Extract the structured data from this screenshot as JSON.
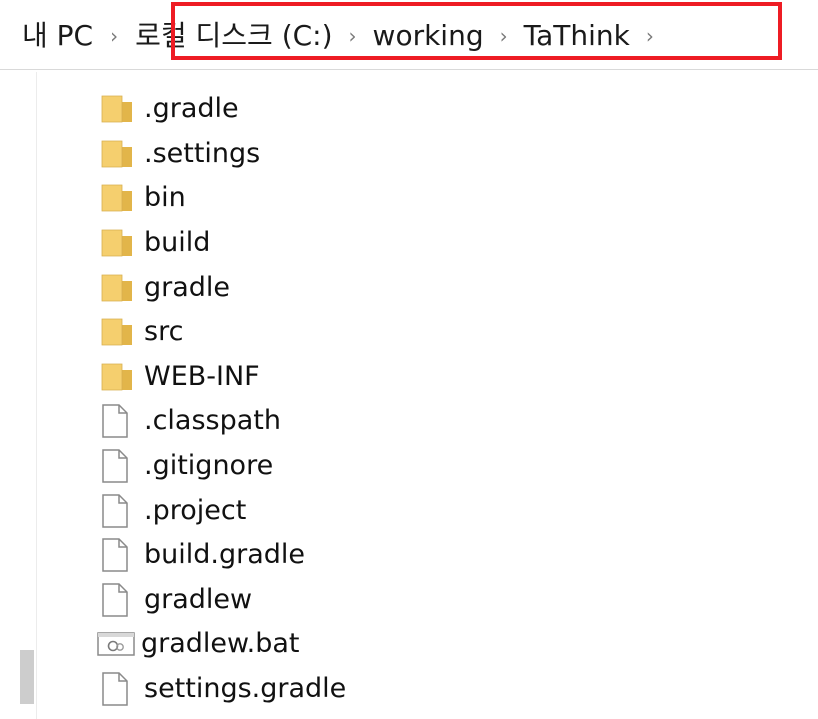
{
  "breadcrumb": {
    "items": [
      {
        "label": "내 PC"
      },
      {
        "label": "로컬 디스크 (C:)"
      },
      {
        "label": "working"
      },
      {
        "label": "TaThink"
      }
    ],
    "separator": "›",
    "highlight_color": "#ee1c24"
  },
  "files": [
    {
      "name": ".gradle",
      "type": "folder",
      "icon": "folder-icon"
    },
    {
      "name": ".settings",
      "type": "folder",
      "icon": "folder-icon"
    },
    {
      "name": "bin",
      "type": "folder",
      "icon": "folder-icon"
    },
    {
      "name": "build",
      "type": "folder",
      "icon": "folder-icon"
    },
    {
      "name": "gradle",
      "type": "folder",
      "icon": "folder-icon"
    },
    {
      "name": "src",
      "type": "folder",
      "icon": "folder-icon"
    },
    {
      "name": "WEB-INF",
      "type": "folder",
      "icon": "folder-icon"
    },
    {
      "name": ".classpath",
      "type": "file",
      "icon": "file-icon"
    },
    {
      "name": ".gitignore",
      "type": "file",
      "icon": "file-icon"
    },
    {
      "name": ".project",
      "type": "file",
      "icon": "file-icon"
    },
    {
      "name": "build.gradle",
      "type": "file",
      "icon": "file-icon"
    },
    {
      "name": "gradlew",
      "type": "file",
      "icon": "file-icon"
    },
    {
      "name": "gradlew.bat",
      "type": "batch",
      "icon": "batch-file-icon"
    },
    {
      "name": "settings.gradle",
      "type": "file",
      "icon": "file-icon"
    }
  ],
  "colors": {
    "folder": "#f5cf6e",
    "folder_dark": "#e2b54a",
    "file_border": "#8a8a8a"
  }
}
